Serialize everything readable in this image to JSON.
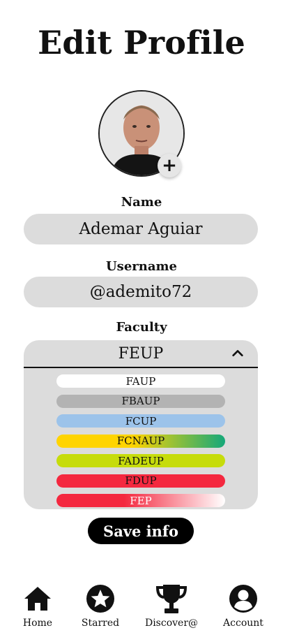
{
  "page": {
    "title": "Edit Profile"
  },
  "profile": {
    "avatar_icon": "profile-photo",
    "add_photo_icon": "plus-icon",
    "add_photo_glyph": "+",
    "name_label": "Name",
    "name_value": "Ademar Aguiar",
    "username_label": "Username",
    "username_value": "@ademito72",
    "faculty_label": "Faculty",
    "faculty_selected": "FEUP"
  },
  "faculty_options": [
    {
      "label": "FAUP",
      "bg": "#ffffff",
      "color": "#111111"
    },
    {
      "label": "FBAUP",
      "bg": "#b3b3b3",
      "color": "#111111"
    },
    {
      "label": "FCUP",
      "bg": "#9cc3ea",
      "color": "#111111"
    },
    {
      "label": "FCNAUP",
      "bg": "linear-gradient(90deg,#ffd400 0%,#ffd400 45%,#15a87a 100%)",
      "color": "#111111"
    },
    {
      "label": "FADEUP",
      "bg": "#c6dc0b",
      "color": "#111111"
    },
    {
      "label": "FDUP",
      "bg": "#f4283f",
      "color": "#111111"
    },
    {
      "label": "FEP",
      "bg": "linear-gradient(90deg,#f4283f 0%,#f4283f 40%,#ffffff 100%)",
      "color": "#ffffff"
    }
  ],
  "actions": {
    "save_label": "Save info"
  },
  "nav": {
    "items": [
      {
        "label": "Home",
        "icon": "home-icon"
      },
      {
        "label": "Starred",
        "icon": "star-icon"
      },
      {
        "label": "Discover@",
        "icon": "trophy-icon"
      },
      {
        "label": "Account",
        "icon": "account-icon"
      }
    ]
  }
}
